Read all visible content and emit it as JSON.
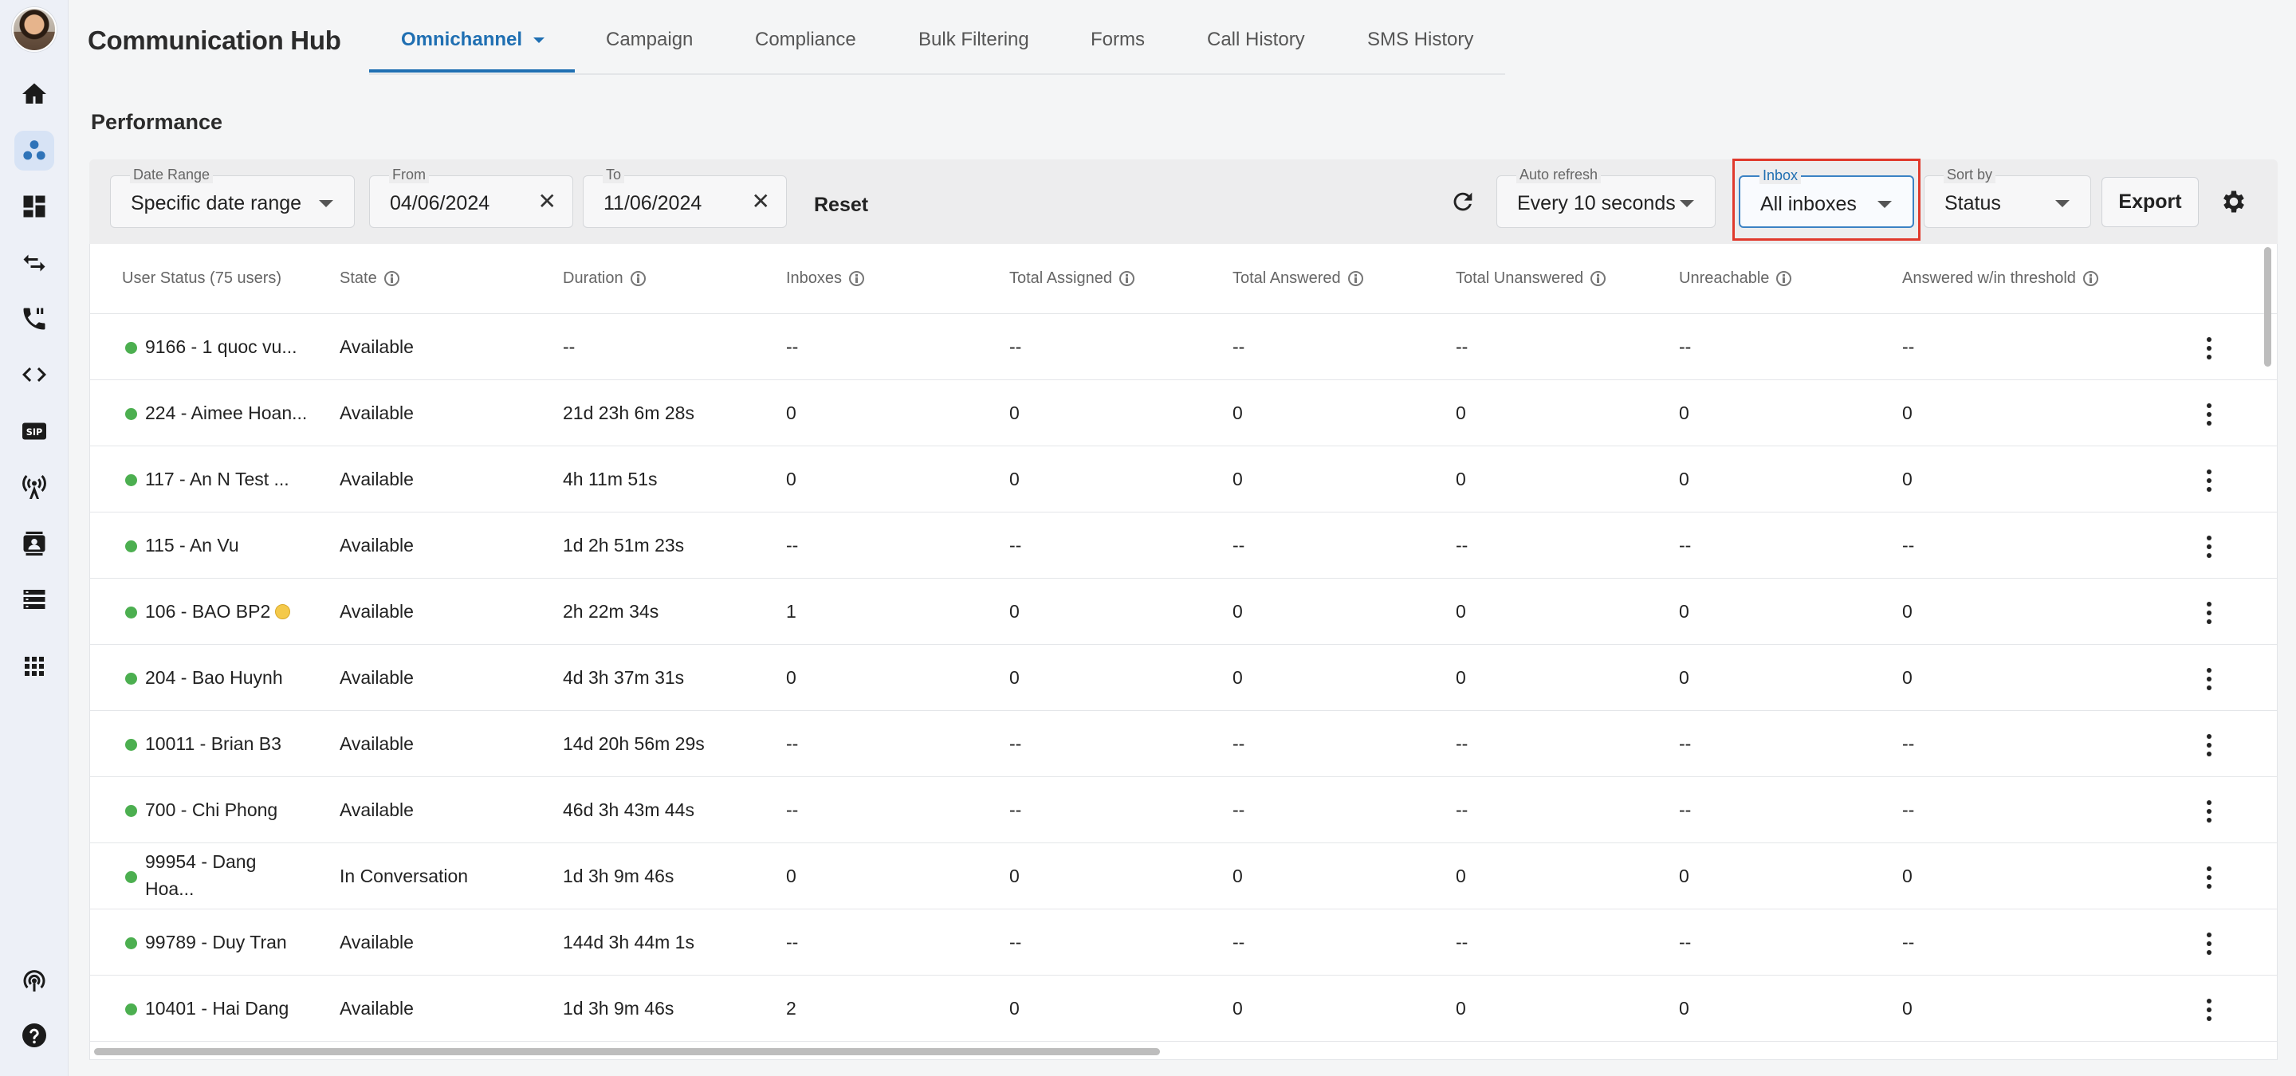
{
  "app": {
    "title": "Communication Hub"
  },
  "tabs": [
    {
      "label": "Omnichannel",
      "active": true
    },
    {
      "label": "Campaign"
    },
    {
      "label": "Compliance"
    },
    {
      "label": "Bulk Filtering"
    },
    {
      "label": "Forms"
    },
    {
      "label": "Call History"
    },
    {
      "label": "SMS History"
    }
  ],
  "section": {
    "title": "Performance"
  },
  "filters": {
    "date_range": {
      "label": "Date Range",
      "value": "Specific date range"
    },
    "from": {
      "label": "From",
      "value": "04/06/2024"
    },
    "to": {
      "label": "To",
      "value": "11/06/2024"
    },
    "reset_label": "Reset",
    "auto_refresh": {
      "label": "Auto refresh",
      "value": "Every 10 seconds"
    },
    "inbox": {
      "label": "Inbox",
      "value": "All inboxes"
    },
    "sort_by": {
      "label": "Sort by",
      "value": "Status"
    },
    "export_label": "Export"
  },
  "table": {
    "headers": {
      "user_status": "User Status (75 users)",
      "state": "State",
      "duration": "Duration",
      "inboxes": "Inboxes",
      "total_assigned": "Total Assigned",
      "total_answered": "Total Answered",
      "total_unanswered": "Total Unanswered",
      "unreachable": "Unreachable",
      "answered_threshold": "Answered w/in threshold"
    },
    "rows": [
      {
        "user": "9166 - 1 quoc vu...",
        "state": "Available",
        "duration": "--",
        "inboxes": "--",
        "assigned": "--",
        "answered": "--",
        "unanswered": "--",
        "unreachable": "--",
        "threshold": "--"
      },
      {
        "user": "224 - Aimee Hoan...",
        "state": "Available",
        "duration": "21d 23h 6m 28s",
        "inboxes": "0",
        "assigned": "0",
        "answered": "0",
        "unanswered": "0",
        "unreachable": "0",
        "threshold": "0"
      },
      {
        "user": "117 - An N Test ...",
        "state": "Available",
        "duration": "4h 11m 51s",
        "inboxes": "0",
        "assigned": "0",
        "answered": "0",
        "unanswered": "0",
        "unreachable": "0",
        "threshold": "0"
      },
      {
        "user": "115 - An Vu",
        "state": "Available",
        "duration": "1d 2h 51m 23s",
        "inboxes": "--",
        "assigned": "--",
        "answered": "--",
        "unanswered": "--",
        "unreachable": "--",
        "threshold": "--"
      },
      {
        "user": "106 - BAO BP2",
        "state": "Available",
        "duration": "2h 22m 34s",
        "inboxes": "1",
        "assigned": "0",
        "answered": "0",
        "unanswered": "0",
        "unreachable": "0",
        "threshold": "0"
      },
      {
        "user": "204 - Bao Huynh",
        "state": "Available",
        "duration": "4d 3h 37m 31s",
        "inboxes": "0",
        "assigned": "0",
        "answered": "0",
        "unanswered": "0",
        "unreachable": "0",
        "threshold": "0"
      },
      {
        "user": "10011 - Brian B3",
        "state": "Available",
        "duration": "14d 20h 56m 29s",
        "inboxes": "--",
        "assigned": "--",
        "answered": "--",
        "unanswered": "--",
        "unreachable": "--",
        "threshold": "--"
      },
      {
        "user": "700 - Chi Phong",
        "state": "Available",
        "duration": "46d 3h 43m 44s",
        "inboxes": "--",
        "assigned": "--",
        "answered": "--",
        "unanswered": "--",
        "unreachable": "--",
        "threshold": "--"
      },
      {
        "user_line1": "99954 - Dang",
        "user_line2": "Hoa...",
        "state": "In Conversation",
        "duration": "1d 3h 9m 46s",
        "inboxes": "0",
        "assigned": "0",
        "answered": "0",
        "unanswered": "0",
        "unreachable": "0",
        "threshold": "0"
      },
      {
        "user": "99789 - Duy Tran",
        "state": "Available",
        "duration": "144d 3h 44m 1s",
        "inboxes": "--",
        "assigned": "--",
        "answered": "--",
        "unanswered": "--",
        "unreachable": "--",
        "threshold": "--"
      },
      {
        "user": "10401 - Hai Dang",
        "state": "Available",
        "duration": "1d 3h 9m 46s",
        "inboxes": "2",
        "assigned": "0",
        "answered": "0",
        "unanswered": "0",
        "unreachable": "0",
        "threshold": "0"
      }
    ]
  },
  "colors": {
    "accent": "#1f6fb2",
    "status_online": "#4caf50",
    "highlight_border": "#e0392c"
  },
  "icons": [
    "home-icon",
    "omnichannel-icon",
    "dashboard-icon",
    "transfer-icon",
    "phone-icon",
    "code-icon",
    "sip-icon",
    "broadcast-icon",
    "contacts-icon",
    "list-icon",
    "apps-icon",
    "signal-icon",
    "help-icon",
    "refresh-icon",
    "gear-icon"
  ]
}
